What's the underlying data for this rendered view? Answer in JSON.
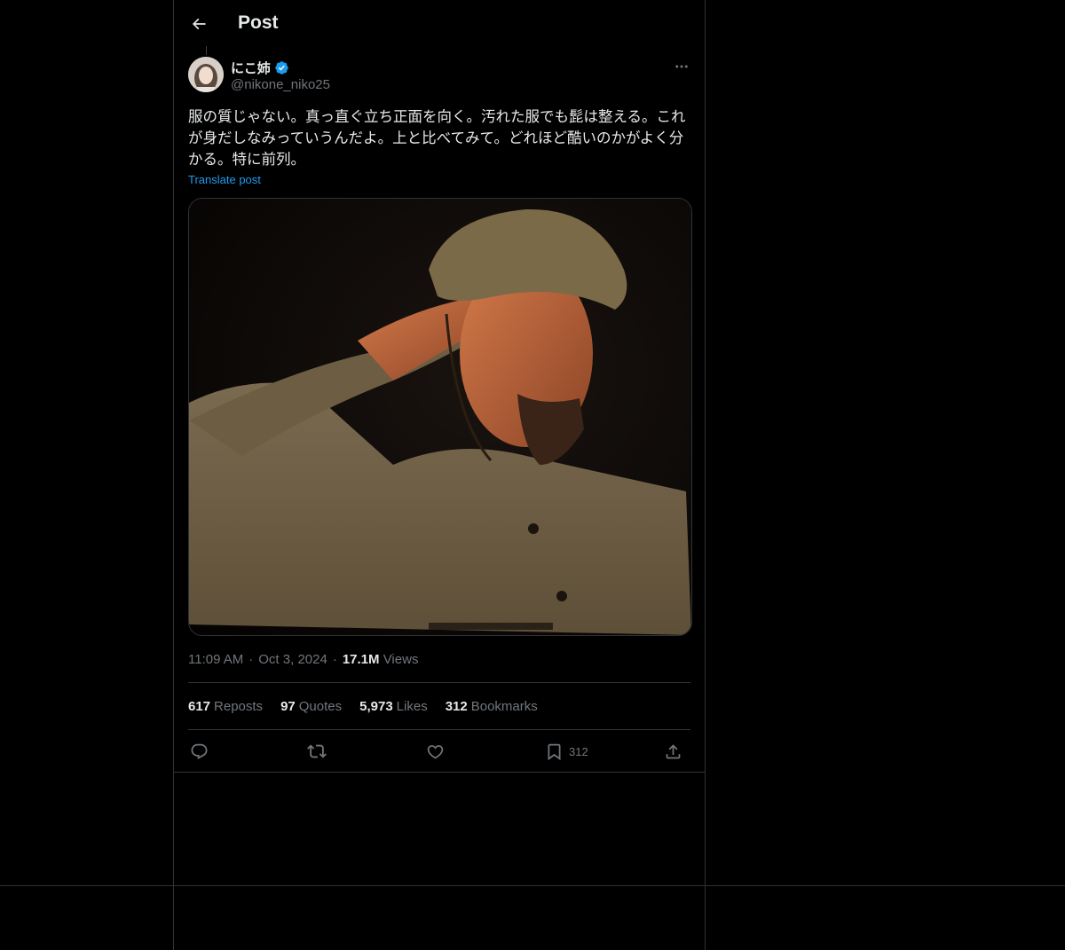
{
  "header": {
    "title": "Post"
  },
  "author": {
    "display_name": "にこ姉",
    "handle": "@nikone_niko25",
    "verified": true
  },
  "post": {
    "text": "服の質じゃない。真っ直ぐ立ち正面を向く。汚れた服でも髭は整える。これが身だしなみっていうんだよ。上と比べてみて。どれほど酷いのかがよく分かる。特に前列。",
    "translate_label": "Translate post",
    "image_description_icon": "photo-of-saluting-soldier"
  },
  "meta": {
    "time": "11:09 AM",
    "date": "Oct 3, 2024",
    "views_count": "17.1M",
    "views_label": "Views"
  },
  "stats": [
    {
      "count": "617",
      "label": "Reposts"
    },
    {
      "count": "97",
      "label": "Quotes"
    },
    {
      "count": "5,973",
      "label": "Likes"
    },
    {
      "count": "312",
      "label": "Bookmarks"
    }
  ],
  "actions": {
    "bookmark_count": "312"
  },
  "colors": {
    "background": "#000000",
    "text": "#e7e9ea",
    "secondary": "#71767b",
    "accent": "#1d9bf0",
    "border": "#2f3336"
  }
}
